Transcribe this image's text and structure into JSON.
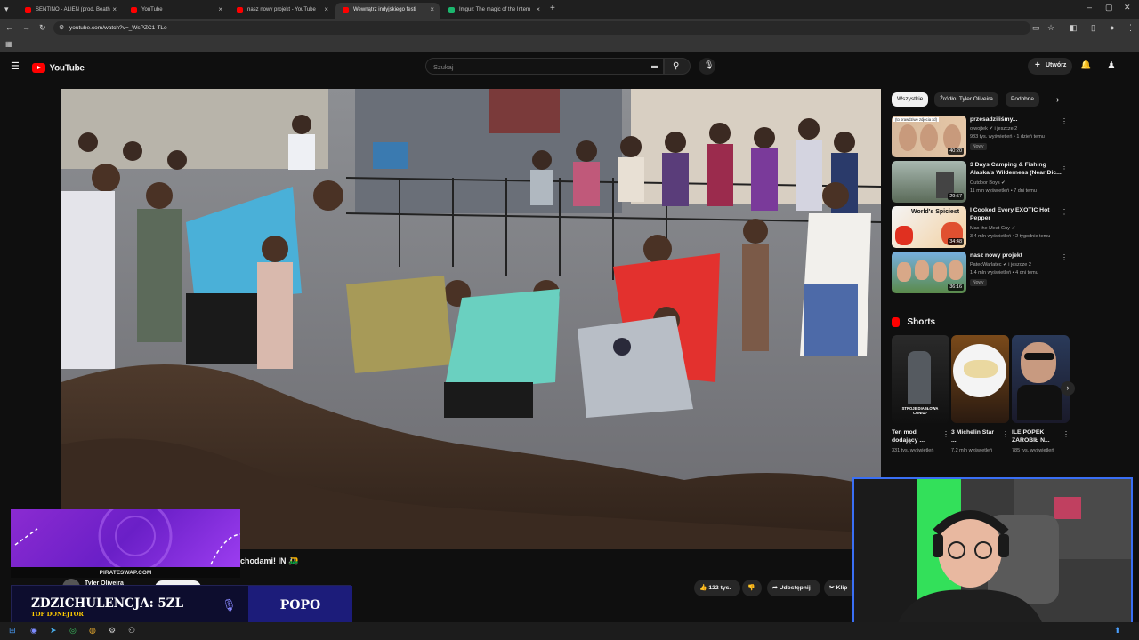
{
  "browser": {
    "tabs": [
      {
        "label": "SENTINO - ALIEN (prod. Beath",
        "favicon_color": "#ff0000",
        "active": false
      },
      {
        "label": "YouTube",
        "favicon_color": "#ff0000",
        "active": false
      },
      {
        "label": "nasz nowy projekt - YouTube",
        "favicon_color": "#ff0000",
        "active": false
      },
      {
        "label": "Wewnątrz indyjskiego festi",
        "favicon_color": "#ff0000",
        "active": true
      },
      {
        "label": "Imgur: The magic of the Intern",
        "favicon_color": "#1bb76e",
        "active": false
      }
    ],
    "url": "youtube.com/watch?v=_WsPZC1-TLo"
  },
  "youtube": {
    "logo_text": "YouTube",
    "search_placeholder": "Szukaj",
    "create_label": "Utwórz",
    "brand_color": "#ff0000"
  },
  "chips": [
    "Wszystkie",
    "Źródło: Tyler Oliveira",
    "Podobne"
  ],
  "related": [
    {
      "title": "przesadziliśmy...",
      "channel": "ojwojtek",
      "channel_suffix": "i jeszcze 2",
      "stats": "983 tys. wyświetleń • 1 dzień temu",
      "badge": "Nowy",
      "duration": "40:20",
      "thumb_text": "(to prawdziwe zdjęcia xd)"
    },
    {
      "title": "3 Days Camping & Fishing Alaska's Wilderness (Near Dic...",
      "channel": "Outdoor Boys",
      "channel_suffix": "",
      "stats": "11 mln wyświetleń • 7 dni temu",
      "badge": "",
      "duration": "29:57",
      "thumb_text": ""
    },
    {
      "title": "I Cooked Every EXOTIC Hot Pepper",
      "channel": "Max the Meat Guy",
      "channel_suffix": "",
      "stats": "3,4 mln wyświetleń • 2 tygodnie temu",
      "badge": "",
      "duration": "34:48",
      "thumb_text": "World's Spiciest"
    },
    {
      "title": "nasz nowy projekt",
      "channel": "PatecWarlatec",
      "channel_suffix": "i jeszcze 2",
      "stats": "1,4 mln wyświetleń • 4 dni temu",
      "badge": "Nowy",
      "duration": "36:16",
      "thumb_text": ""
    }
  ],
  "shorts_heading": "Shorts",
  "shorts": [
    {
      "title": "Ten mod dodający ...",
      "views": "331 tys. wyświetleń",
      "thumb_text": "STROJE DIABŁOWA CONIU?"
    },
    {
      "title": "3 Michelin Star ...",
      "views": "7,2 mln wyświetleń",
      "thumb_text": ""
    },
    {
      "title": "ILE POPEK ZAROBIŁ N...",
      "views": "785 tys. wyświetleń",
      "thumb_text": ""
    }
  ],
  "video": {
    "title_visible": "chodami! IN 🛺",
    "channel_visible": "Tyler Oliveira",
    "likes": "122 tys.",
    "share_label": "Udostępnij",
    "clip_label": "Klip"
  },
  "overlay": {
    "promo": "PIRATESWAP.COM",
    "alert_label": "ZDZICHULENCJA: 5ZL",
    "alert_sub": "TOP DONEJTOR",
    "alert_name": "POPO"
  }
}
